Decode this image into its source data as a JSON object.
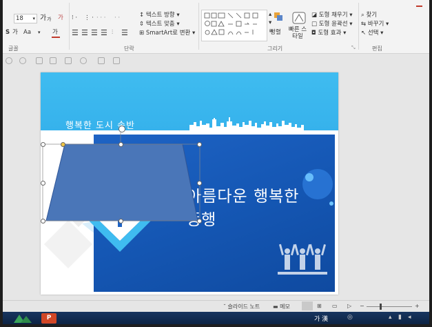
{
  "ribbon": {
    "font_size": "18",
    "font_grow_label": "가",
    "font_shrink_label": "가",
    "clear_format_label": "가",
    "shadow_label": "S",
    "char_spacing_label": "가",
    "case_label": "Aa",
    "font_color_label": "가",
    "text_direction_label": "텍스트 방향",
    "align_text_label": "텍스트 맞춤",
    "smartart_label": "SmartArt로 변환",
    "arrange_label": "정렬",
    "quick_styles_label": "빠른 스타일",
    "shape_fill_label": "도형 채우기",
    "shape_outline_label": "도형 윤곽선",
    "shape_effects_label": "도형 효과",
    "find_label": "찾기",
    "replace_label": "바꾸기",
    "select_label": "선택",
    "groups": {
      "font": "글꼴",
      "paragraph": "단락",
      "drawing": "그리기",
      "editing": "편집"
    }
  },
  "slide": {
    "subtitle": "행복한 도시 속반",
    "title_line1": "아름다운 행복한",
    "title_line2": "동행"
  },
  "statusbar": {
    "notes_label": "슬라이드 노트",
    "comments_label": "메모"
  },
  "taskbar": {
    "ime_label": "가 漢",
    "app_icon_label": "P"
  },
  "colors": {
    "ribbon_bg": "#f3f3f3",
    "slide_band": "#3fbcf0",
    "slide_main": "#1557b4",
    "shape_fill": "#4a76b8",
    "taskbar": "#0d2444"
  }
}
